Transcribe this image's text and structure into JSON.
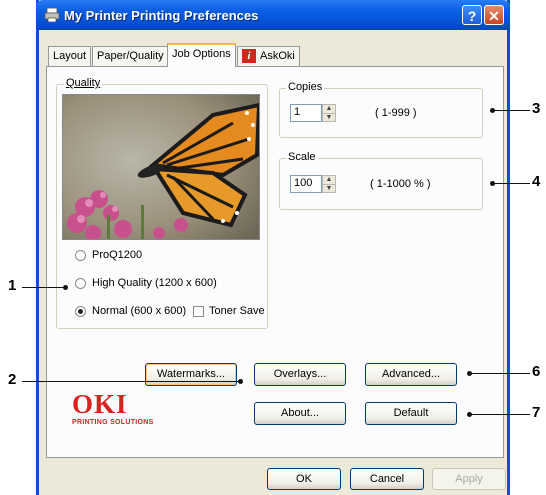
{
  "window": {
    "title": "My Printer Printing Preferences",
    "help_label": "?",
    "close_label": "✕"
  },
  "tabs": [
    {
      "label": "Layout"
    },
    {
      "label": "Paper/Quality"
    },
    {
      "label": "Job Options"
    },
    {
      "label": "AskOki"
    }
  ],
  "quality": {
    "group_label": "Quality",
    "options": [
      {
        "label": "ProQ1200",
        "checked": false
      },
      {
        "label": "High Quality (1200 x 600)",
        "checked": false
      },
      {
        "label": "Normal (600 x 600)",
        "checked": true
      }
    ],
    "toner_save_label": "Toner Save",
    "toner_save_checked": false
  },
  "copies": {
    "group_label": "Copies",
    "value": "1",
    "range": "( 1-999 )"
  },
  "scale": {
    "group_label": "Scale",
    "value": "100",
    "range": "( 1-1000 % )"
  },
  "buttons": {
    "watermarks": "Watermarks...",
    "overlays": "Overlays...",
    "advanced": "Advanced...",
    "about": "About...",
    "default": "Default",
    "ok": "OK",
    "cancel": "Cancel",
    "apply": "Apply"
  },
  "logo": {
    "brand": "OKI",
    "tagline": "PRINTING SOLUTIONS",
    "color": "#d8231f"
  },
  "callouts": [
    "1",
    "2",
    "3",
    "4",
    "6",
    "7"
  ]
}
